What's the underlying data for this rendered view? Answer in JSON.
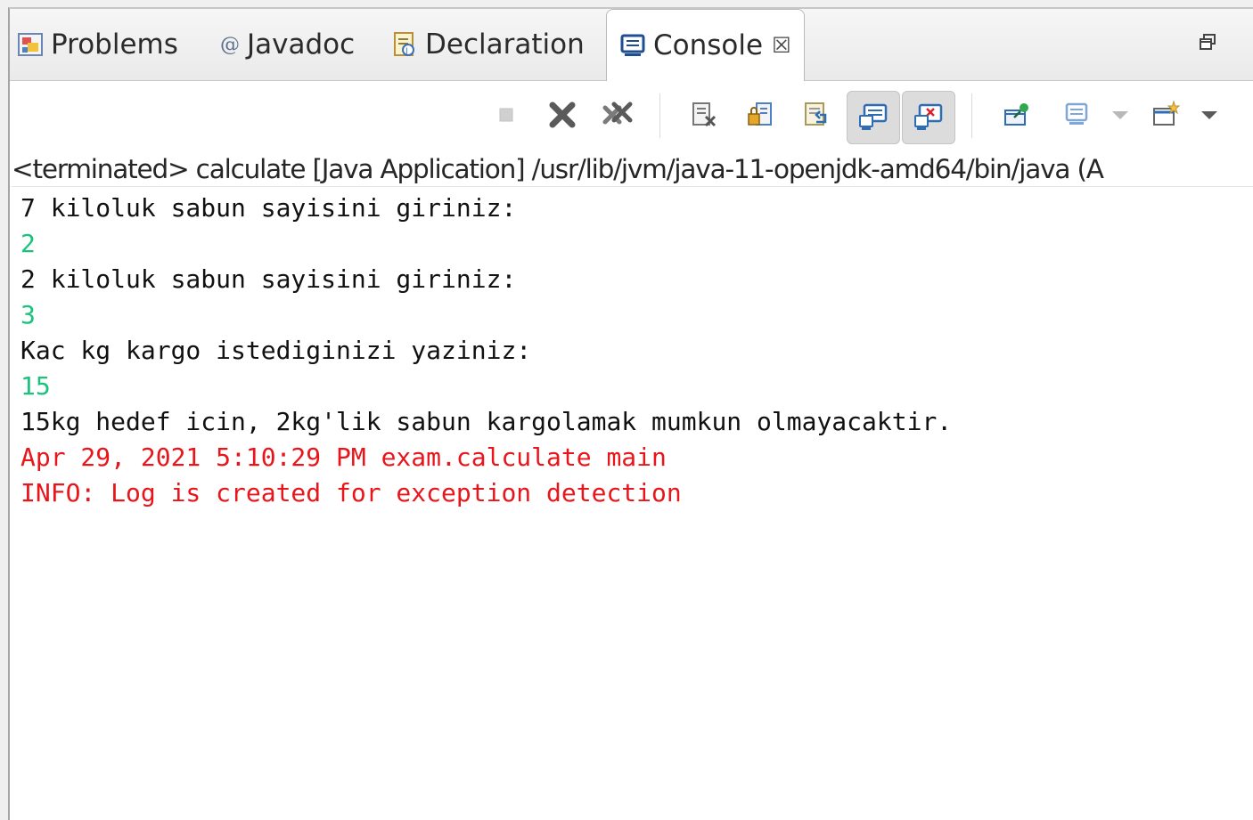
{
  "tabs": [
    {
      "label": "Problems",
      "icon": "problems-icon"
    },
    {
      "label": "Javadoc",
      "icon": "javadoc-icon"
    },
    {
      "label": "Declaration",
      "icon": "declaration-icon"
    },
    {
      "label": "Console",
      "icon": "console-icon",
      "active": true,
      "close_glyph": "☒"
    }
  ],
  "toolbar": {
    "buttons": [
      "terminate-icon",
      "remove-launch-icon",
      "remove-all-terminated-icon",
      "clear-console-icon",
      "scroll-lock-icon",
      "word-wrap-icon",
      "show-on-stdout-icon",
      "show-on-stderr-icon",
      "pin-console-icon",
      "display-selected-console-icon",
      "open-console-icon"
    ]
  },
  "status_line": "<terminated> calculate [Java Application] /usr/lib/jvm/java-11-openjdk-amd64/bin/java (A",
  "console": {
    "lines": [
      {
        "text": "7 kiloluk sabun sayisini giriniz:",
        "type": "stdout"
      },
      {
        "text": "2",
        "type": "stdin"
      },
      {
        "text": "2 kiloluk sabun sayisini giriniz:",
        "type": "stdout"
      },
      {
        "text": "3",
        "type": "stdin"
      },
      {
        "text": "Kac kg kargo istediginizi yaziniz:",
        "type": "stdout"
      },
      {
        "text": "15",
        "type": "stdin"
      },
      {
        "text": "15kg hedef icin, 2kg'lik sabun kargolamak mumkun olmayacaktir.",
        "type": "stdout"
      },
      {
        "text": "Apr 29, 2021 5:10:29 PM exam.calculate main",
        "type": "stderr"
      },
      {
        "text": "INFO: Log is created for exception detection",
        "type": "stderr"
      }
    ]
  },
  "colors": {
    "stdout": "#111111",
    "stdin": "#19c37d",
    "stderr": "#e8151b"
  }
}
